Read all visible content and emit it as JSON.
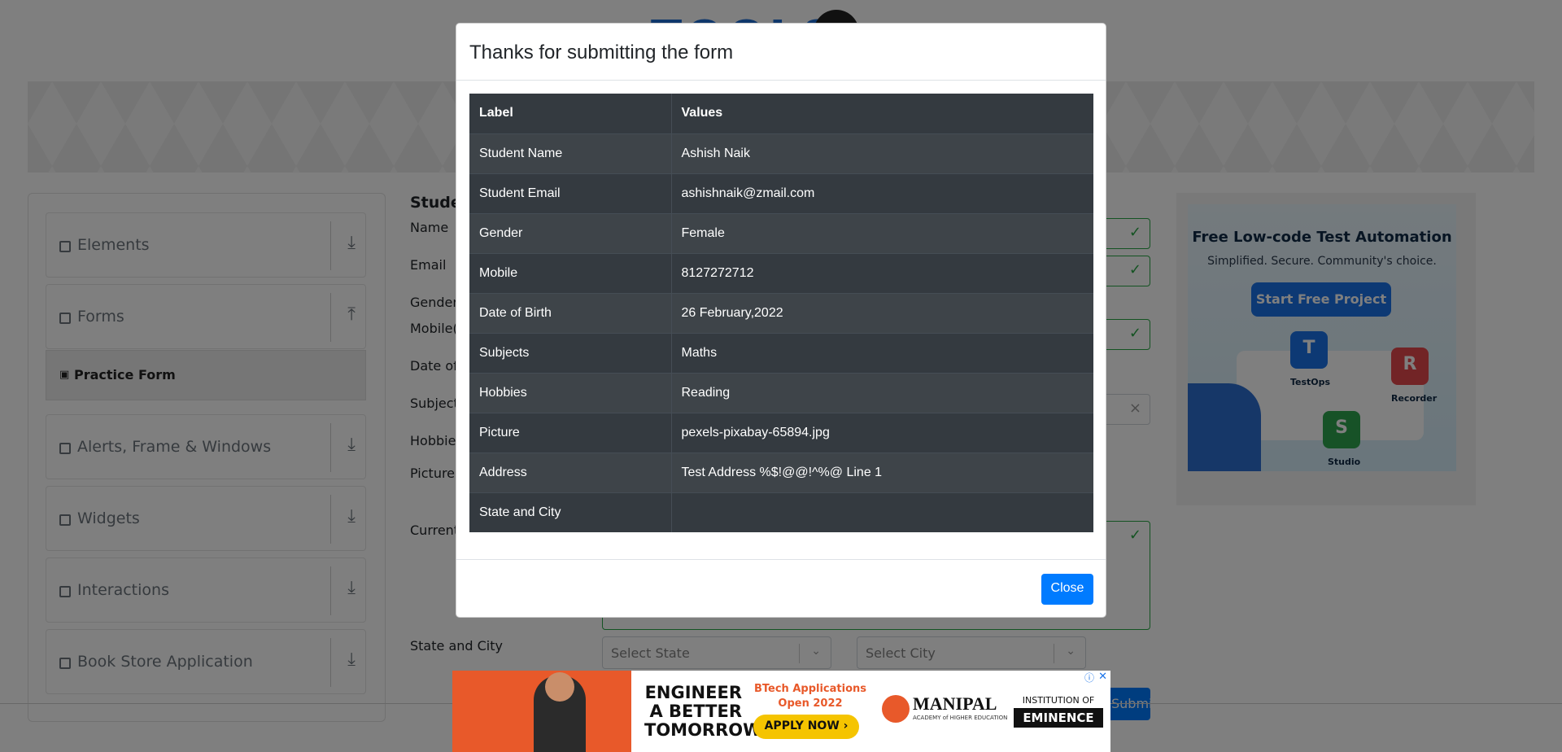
{
  "sidebar": {
    "groups": [
      {
        "label": "Elements",
        "icon": "list-icon",
        "arrow": "download-arrow-icon"
      },
      {
        "label": "Forms",
        "icon": "clipboard-icon",
        "arrow": "upload-arrow-icon"
      },
      {
        "label": "Alerts, Frame & Windows",
        "icon": "window-icon",
        "arrow": "download-arrow-icon"
      },
      {
        "label": "Widgets",
        "icon": "grid-icon",
        "arrow": "download-arrow-icon"
      },
      {
        "label": "Interactions",
        "icon": "swap-icon",
        "arrow": "download-arrow-icon"
      },
      {
        "label": "Book Store Application",
        "icon": "books-icon",
        "arrow": "download-arrow-icon"
      }
    ],
    "active_item": "Practice Form"
  },
  "form": {
    "heading": "Studen",
    "labels": {
      "name": "Name",
      "email": "Email",
      "gender": "Gender",
      "mobile": "Mobile(",
      "dob": "Date of",
      "subjects": "Subjects",
      "hobbies": "Hobbies",
      "picture": "Picture",
      "address": "Current",
      "state_city": "State and City"
    },
    "state_placeholder": "Select State",
    "city_placeholder": "Select City",
    "submit_label": "Submit"
  },
  "side_ad": {
    "title": "Free Low-code Test Automation",
    "subtitle": "Simplified. Secure. Community's choice.",
    "cta": "Start Free Project",
    "testops": "TestOps",
    "recorder": "Recorder",
    "studio": "Studio"
  },
  "modal": {
    "title": "Thanks for submitting the form",
    "columns": [
      "Label",
      "Values"
    ],
    "rows": [
      {
        "label": "Student Name",
        "value": "Ashish Naik"
      },
      {
        "label": "Student Email",
        "value": "ashishnaik@zmail.com"
      },
      {
        "label": "Gender",
        "value": "Female"
      },
      {
        "label": "Mobile",
        "value": "8127272712"
      },
      {
        "label": "Date of Birth",
        "value": "26 February,2022"
      },
      {
        "label": "Subjects",
        "value": "Maths"
      },
      {
        "label": "Hobbies",
        "value": "Reading"
      },
      {
        "label": "Picture",
        "value": "pexels-pixabay-65894.jpg"
      },
      {
        "label": "Address",
        "value": "Test Address %$!@@!^%@ Line 1"
      },
      {
        "label": "State and City",
        "value": ""
      }
    ],
    "close_label": "Close"
  },
  "bottom_ad": {
    "headline_1": "ENGINEER",
    "headline_2": "A BETTER",
    "headline_3": "TOMORROW",
    "btech_1": "BTech Applications",
    "btech_2": "Open 2022",
    "apply": "APPLY NOW ›",
    "manipal": "MANIPAL",
    "manipal_sub": "ACADEMY of HIGHER EDUCATION",
    "institution": "INSTITUTION OF",
    "eminence": "EMINENCE"
  },
  "colors": {
    "primary": "#007bff",
    "success": "#28a745",
    "table_dark": "#343a40",
    "overlay": "rgba(0,0,0,0.5)"
  }
}
